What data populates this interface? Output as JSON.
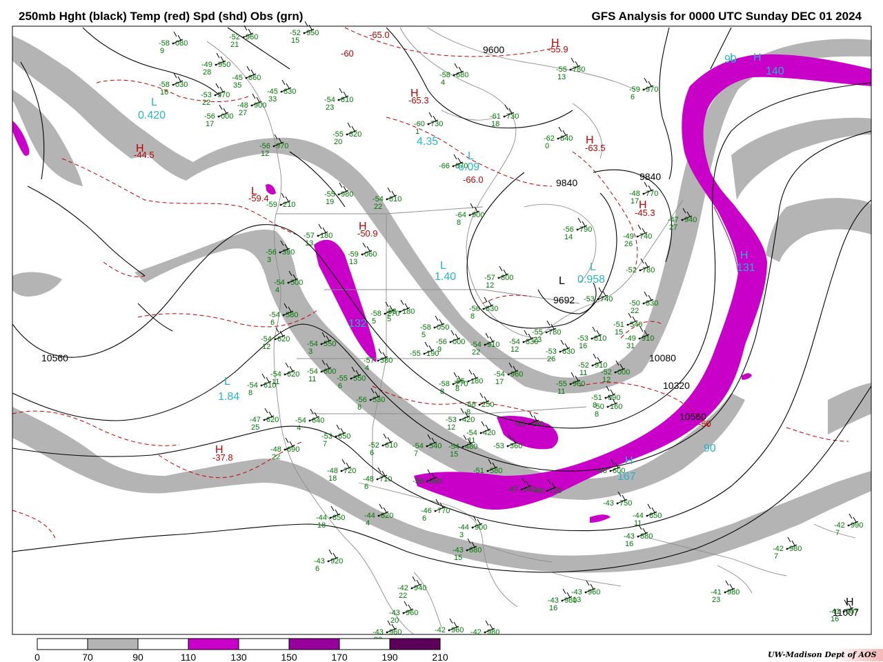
{
  "header": {
    "title_left": "250mb Hght (black) Temp (red) Spd (shd) Obs (grn)",
    "title_right": "GFS Analysis for 0000 UTC Sunday  DEC 01 2024"
  },
  "colors": {
    "height_contour": "#000000",
    "temperature_contour": "#c00000",
    "speed_70_90": "#b4b4b4",
    "speed_110_130": "#c800c8",
    "speed_150_170": "#96009b",
    "speed_190_210": "#5a005a",
    "observation": "#007800",
    "wind_analysis_label": "#28b4c8",
    "border": "#808080"
  },
  "colorbar": {
    "ticks": [
      "0",
      "70",
      "90",
      "110",
      "130",
      "150",
      "170",
      "190",
      "210"
    ]
  },
  "height_labels": [
    {
      "text": "10560"
    },
    {
      "text": "9600"
    },
    {
      "text": "9840"
    },
    {
      "text": "9840"
    },
    {
      "text": "9692"
    },
    {
      "text": "10080"
    },
    {
      "text": "10320"
    },
    {
      "text": "10560"
    },
    {
      "text": "11007"
    }
  ],
  "temp_labels": [
    {
      "text": "-65.0"
    },
    {
      "text": "-60"
    },
    {
      "text": "-55.9"
    },
    {
      "text": "-65.3"
    },
    {
      "text": "-44.5"
    },
    {
      "text": "-66.0"
    },
    {
      "text": "-63.5"
    },
    {
      "text": "-59.4"
    },
    {
      "text": "-50.9"
    },
    {
      "text": "-45.3"
    },
    {
      "text": "-37.8"
    },
    {
      "text": "-50"
    }
  ],
  "speed_labels": [
    {
      "text": "0.420"
    },
    {
      "text": "4.35"
    },
    {
      "text": "6.09"
    },
    {
      "text": "140"
    },
    {
      "text": "131"
    },
    {
      "text": "0.958"
    },
    {
      "text": "1.40"
    },
    {
      "text": "132"
    },
    {
      "text": "1.84"
    },
    {
      "text": "90"
    },
    {
      "text": "167"
    },
    {
      "text": "90"
    }
  ],
  "pressure_marks": [
    {
      "text": "L"
    },
    {
      "text": "L"
    },
    {
      "text": "L"
    },
    {
      "text": "L"
    },
    {
      "text": "L"
    },
    {
      "text": "L"
    },
    {
      "text": "L"
    },
    {
      "text": "L"
    },
    {
      "text": "H"
    },
    {
      "text": "H"
    },
    {
      "text": "H"
    },
    {
      "text": "H"
    },
    {
      "text": "H"
    },
    {
      "text": "H"
    },
    {
      "text": "H"
    },
    {
      "text": "H"
    },
    {
      "text": "H"
    },
    {
      "text": "H"
    },
    {
      "text": "H"
    }
  ],
  "observations": [
    {
      "t": "-58",
      "h": "080",
      "d": "9"
    },
    {
      "t": "-52",
      "h": "960",
      "d": "21"
    },
    {
      "t": "-52",
      "h": "950",
      "d": "15"
    },
    {
      "t": "-49",
      "h": "950",
      "d": "28"
    },
    {
      "t": "-45",
      "h": "860",
      "d": "35"
    },
    {
      "t": "-45",
      "h": "830",
      "d": "33"
    },
    {
      "t": "-58",
      "h": "030",
      "d": "16"
    },
    {
      "t": "-53",
      "h": "970",
      "d": "22"
    },
    {
      "t": "-48",
      "h": "900",
      "d": "27"
    },
    {
      "t": "-56",
      "h": "000",
      "d": "17"
    },
    {
      "t": "-54",
      "h": "810",
      "d": "23"
    },
    {
      "t": "-58",
      "h": "680",
      "d": "4"
    },
    {
      "t": "-55",
      "h": "780",
      "d": "13"
    },
    {
      "t": "-61",
      "h": "730",
      "d": "18"
    },
    {
      "t": "-60",
      "h": "730",
      "d": "1"
    },
    {
      "t": "-59",
      "h": "970",
      "d": "6"
    },
    {
      "t": "-55",
      "h": "820",
      "d": "20"
    },
    {
      "t": "-62",
      "h": "840",
      "d": "0"
    },
    {
      "t": "-56",
      "h": "970",
      "d": "12"
    },
    {
      "t": "-66",
      "h": "870",
      "d": ""
    },
    {
      "t": "-54",
      "h": "810",
      "d": "22"
    },
    {
      "t": "-55",
      "h": "980",
      "d": "19"
    },
    {
      "t": "-59",
      "h": "210",
      "d": ""
    },
    {
      "t": "-48",
      "h": "770",
      "d": "17"
    },
    {
      "t": "-64",
      "h": "900",
      "d": "8"
    },
    {
      "t": "-47",
      "h": "940",
      "d": "27"
    },
    {
      "t": "-56",
      "h": "790",
      "d": "14"
    },
    {
      "t": "-49",
      "h": "740",
      "d": "26"
    },
    {
      "t": "-57",
      "h": "180",
      "d": "13"
    },
    {
      "t": "-59",
      "h": "060",
      "d": "13"
    },
    {
      "t": "-56",
      "h": "390",
      "d": "3"
    },
    {
      "t": "-57",
      "h": "800",
      "d": "12"
    },
    {
      "t": "-52",
      "h": "780",
      "d": ""
    },
    {
      "t": "-54",
      "h": "500",
      "d": "4"
    },
    {
      "t": "-50",
      "h": "830",
      "d": "22"
    },
    {
      "t": "-53",
      "h": "740",
      "d": ""
    },
    {
      "t": "-58",
      "h": "270",
      "d": "5"
    },
    {
      "t": "-58",
      "h": "180",
      "d": "5"
    },
    {
      "t": "-56",
      "h": "830",
      "d": "8"
    },
    {
      "t": "-54",
      "h": "580",
      "d": "6"
    },
    {
      "t": "-51",
      "h": "540",
      "d": "15"
    },
    {
      "t": "-58",
      "h": "050",
      "d": "5"
    },
    {
      "t": "-55",
      "h": "780",
      "d": "23"
    },
    {
      "t": "-53",
      "h": "810",
      "d": "16"
    },
    {
      "t": "-49",
      "h": "910",
      "d": "31"
    },
    {
      "t": "-54",
      "h": "620",
      "d": "12"
    },
    {
      "t": "-54",
      "h": "550",
      "d": "3"
    },
    {
      "t": "-56",
      "h": "000",
      "d": "9"
    },
    {
      "t": "-54",
      "h": "910",
      "d": "22"
    },
    {
      "t": "-54",
      "h": "830",
      "d": "12"
    },
    {
      "t": "-53",
      "h": "830",
      "d": "26"
    },
    {
      "t": "-57",
      "h": "380",
      "d": "4"
    },
    {
      "t": "-55",
      "h": "190",
      "d": ""
    },
    {
      "t": "-54",
      "h": "620",
      "d": "11"
    },
    {
      "t": "-54",
      "h": "600",
      "d": "11"
    },
    {
      "t": "-55",
      "h": "550",
      "d": "6"
    },
    {
      "t": "-52",
      "h": "910",
      "d": "11"
    },
    {
      "t": "-52",
      "h": "000",
      "d": "12"
    },
    {
      "t": "-54",
      "h": "610",
      "d": "8"
    },
    {
      "t": "-58",
      "h": "270",
      "d": "8"
    },
    {
      "t": "-55",
      "h": "180",
      "d": "8"
    },
    {
      "t": "-54",
      "h": "960",
      "d": "17"
    },
    {
      "t": "-55",
      "h": "960",
      "d": "11"
    },
    {
      "t": "-51",
      "h": "090",
      "d": "8"
    },
    {
      "t": "-56",
      "h": "530",
      "d": "8"
    },
    {
      "t": "-58",
      "h": "250",
      "d": "8"
    },
    {
      "t": "-50",
      "h": "160",
      "d": "8"
    },
    {
      "t": "-47",
      "h": "620",
      "d": "25"
    },
    {
      "t": "-54",
      "h": "640",
      "d": "4"
    },
    {
      "t": "-53",
      "h": "420",
      "d": "12"
    },
    {
      "t": "-54",
      "h": "420",
      "d": "11"
    },
    {
      "t": "-53",
      "h": "180",
      "d": ""
    },
    {
      "t": "-53",
      "h": "650",
      "d": "7"
    },
    {
      "t": "-52",
      "h": "610",
      "d": "6"
    },
    {
      "t": "-54",
      "h": "540",
      "d": "7"
    },
    {
      "t": "-48",
      "h": "690",
      "d": "22"
    },
    {
      "t": "-54",
      "h": "480",
      "d": "15"
    },
    {
      "t": "-53",
      "h": "360",
      "d": ""
    },
    {
      "t": "-48",
      "h": "720",
      "d": "18"
    },
    {
      "t": "-48",
      "h": "710",
      "d": "6"
    },
    {
      "t": "-51",
      "h": "580",
      "d": ""
    },
    {
      "t": "-58",
      "h": "660",
      "d": ""
    },
    {
      "t": "-48",
      "h": "600",
      "d": ""
    },
    {
      "t": "-47",
      "h": "640",
      "d": ""
    },
    {
      "t": "-48",
      "h": "720",
      "d": ""
    },
    {
      "t": "-44",
      "h": "850",
      "d": "18"
    },
    {
      "t": "-44",
      "h": "820",
      "d": "4"
    },
    {
      "t": "-46",
      "h": "770",
      "d": "6"
    },
    {
      "t": "-43",
      "h": "750",
      "d": ""
    },
    {
      "t": "-44",
      "h": "850",
      "d": "11"
    },
    {
      "t": "-44",
      "h": "900",
      "d": "3"
    },
    {
      "t": "-43",
      "h": "880",
      "d": "15"
    },
    {
      "t": "-43",
      "h": "880",
      "d": "16"
    },
    {
      "t": "-43",
      "h": "920",
      "d": "6"
    },
    {
      "t": "-42",
      "h": "990",
      "d": "7"
    },
    {
      "t": "-42",
      "h": "980",
      "d": "7"
    },
    {
      "t": "-42",
      "h": "940",
      "d": "22"
    },
    {
      "t": "-43",
      "h": "960",
      "d": "20"
    },
    {
      "t": "-43",
      "h": "960",
      "d": "13"
    },
    {
      "t": "-43",
      "h": "980",
      "d": "16"
    },
    {
      "t": "-41",
      "h": "980",
      "d": "23"
    },
    {
      "t": "-43",
      "h": "960",
      "d": "20"
    },
    {
      "t": "-42",
      "h": "960",
      "d": ""
    },
    {
      "t": "-42",
      "h": "980",
      "d": ""
    },
    {
      "t": "-41",
      "h": "007",
      "d": "16"
    }
  ],
  "credit": {
    "text": "UW-Madison   Dept of AOS"
  }
}
